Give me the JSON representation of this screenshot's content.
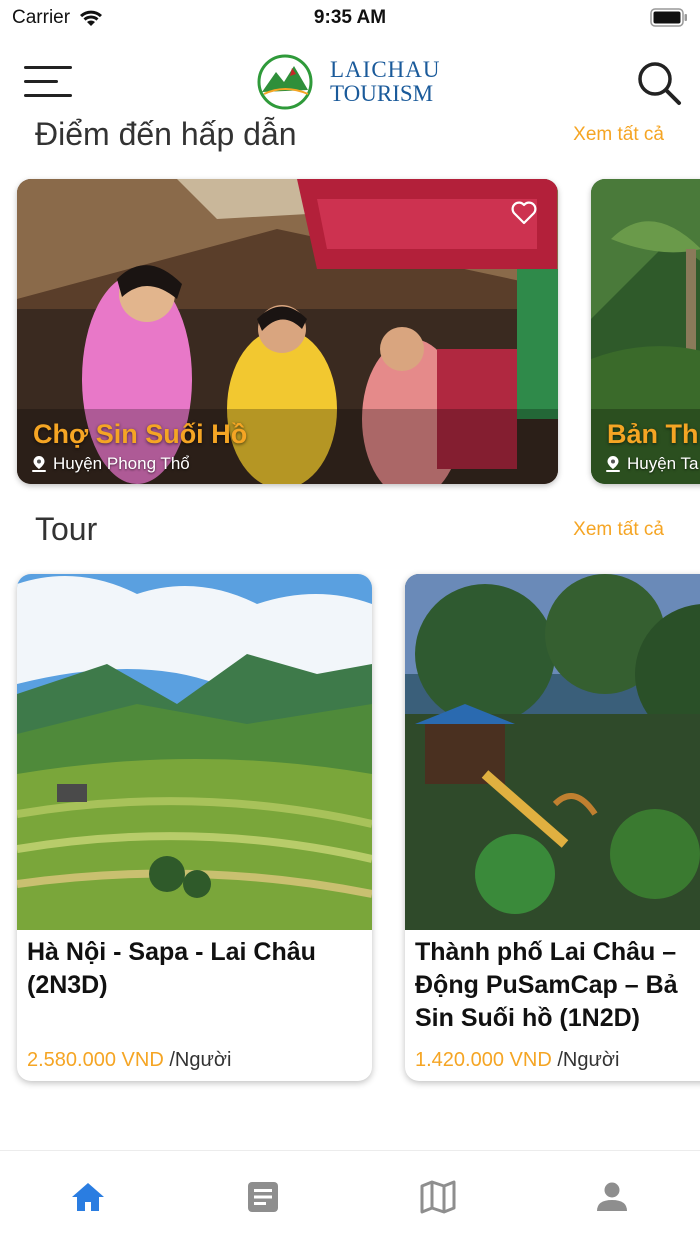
{
  "status_bar": {
    "carrier": "Carrier",
    "time": "9:35 AM"
  },
  "header": {
    "logo_line1": "LAICHAU",
    "logo_line2": "TOURISM",
    "logo_badge": "LaiChâu"
  },
  "destinations": {
    "title": "Điểm đến hấp dẫn",
    "see_all": "Xem tất cả",
    "items": [
      {
        "name": "Chợ Sin Suối Hồ",
        "location": "Huyện Phong Thổ"
      },
      {
        "name": "Bản Th",
        "location": "Huyện Ta"
      }
    ]
  },
  "tours": {
    "title": "Tour",
    "see_all": "Xem tất cả",
    "items": [
      {
        "title_lines": [
          "Hà Nội - Sapa - Lai Châu",
          "(2N3D)"
        ],
        "price": "2.580.000 VND",
        "unit": " /Người"
      },
      {
        "title_lines": [
          "Thành phố Lai Châu –",
          "Động PuSamCap – Bả",
          "Sin Suối hồ (1N2D)"
        ],
        "price": "1.420.000 VND",
        "unit": " /Người"
      }
    ]
  },
  "tabbar": {
    "tabs": [
      {
        "icon": "home-icon",
        "active": true
      },
      {
        "icon": "news-icon",
        "active": false
      },
      {
        "icon": "map-icon",
        "active": false
      },
      {
        "icon": "profile-icon",
        "active": false
      }
    ]
  },
  "colors": {
    "accent": "#f5a524",
    "tab_active": "#2a7de1",
    "tab_inactive": "#8e8e8e",
    "brand": "#1a5a9a"
  }
}
